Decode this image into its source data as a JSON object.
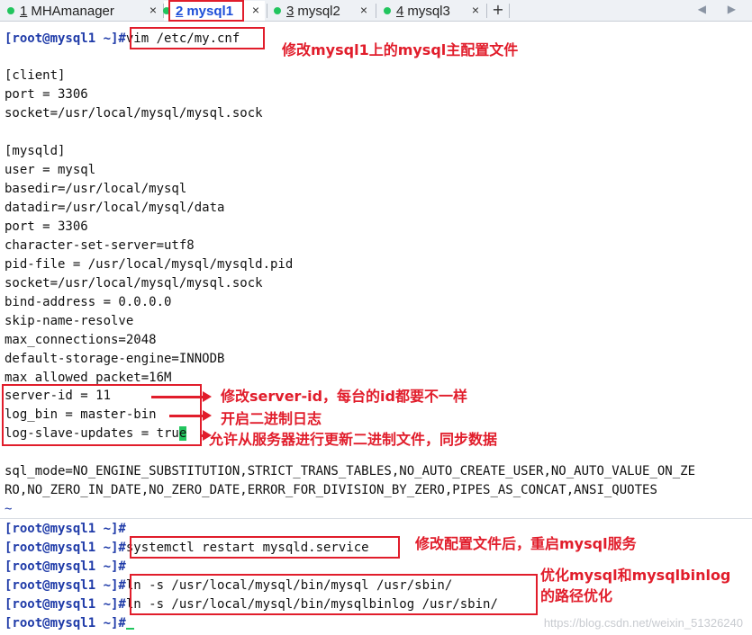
{
  "tabs": [
    {
      "num": "1",
      "label": "MHAmanager",
      "active": false
    },
    {
      "num": "2",
      "label": "mysql1",
      "active": true
    },
    {
      "num": "3",
      "label": "mysql2",
      "active": false
    },
    {
      "num": "4",
      "label": "mysql3",
      "active": false
    }
  ],
  "tab_close_glyph": "×",
  "add_tab_glyph": "+",
  "nav_glyphs": "◀ ▶",
  "prompt": "[root@mysql1 ~]#",
  "terminal": {
    "cmd_vim": "vim /etc/my.cnf",
    "config_lines": [
      "",
      "[client]",
      "port = 3306",
      "socket=/usr/local/mysql/mysql.sock",
      "",
      "[mysqld]",
      "user = mysql",
      "basedir=/usr/local/mysql",
      "datadir=/usr/local/mysql/data",
      "port = 3306",
      "character-set-server=utf8",
      "pid-file = /usr/local/mysql/mysqld.pid",
      "socket=/usr/local/mysql/mysql.sock",
      "bind-address = 0.0.0.0",
      "skip-name-resolve",
      "max_connections=2048",
      "default-storage-engine=INNODB",
      "max_allowed_packet=16M",
      "server-id = 11",
      "log_bin = master-bin",
      "log-slave-updates = tru",
      "",
      "sql_mode=NO_ENGINE_SUBSTITUTION,STRICT_TRANS_TABLES,NO_AUTO_CREATE_USER,NO_AUTO_VALUE_ON_ZE",
      "RO,NO_ZERO_IN_DATE,NO_ZERO_DATE,ERROR_FOR_DIVISION_BY_ZERO,PIPES_AS_CONCAT,ANSI_QUOTES",
      "~"
    ],
    "cursor_char": "e",
    "cmd_restart": "systemctl restart mysqld.service",
    "cmd_ln1": "ln -s /usr/local/mysql/bin/mysql /usr/sbin/",
    "cmd_ln2": "ln -s /usr/local/mysql/bin/mysqlbinlog /usr/sbin/"
  },
  "annotations": {
    "vim_note": "修改mysql1上的mysql主配置文件",
    "server_id_note": "修改server-id，每台的id都要不一样",
    "log_bin_note": "开启二进制日志",
    "slave_updates_note": "允许从服务器进行更新二进制文件，同步数据",
    "restart_note": "修改配置文件后，重启mysql服务",
    "ln_note_1": "优化mysql和mysqlbinlog",
    "ln_note_2": "的路径优化"
  },
  "watermark": "https://blog.csdn.net/weixin_51326240",
  "colors": {
    "annotation_red": "#e11d2b",
    "prompt_blue": "#1e3aa8",
    "cursor_green": "#22c55e",
    "active_tab_blue": "#1d4ed8"
  }
}
